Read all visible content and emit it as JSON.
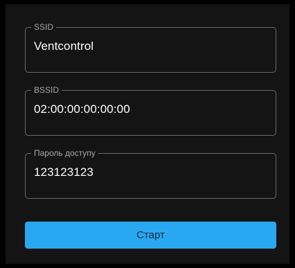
{
  "form": {
    "ssid": {
      "label": "SSID",
      "value": "Ventcontrol"
    },
    "bssid": {
      "label": "BSSID",
      "value": "02:00:00:00:00:00"
    },
    "password": {
      "label": "Пароль доступу",
      "value": "123123123"
    },
    "start_label": "Старт"
  },
  "colors": {
    "background": "#141414",
    "accent": "#29a8f2"
  }
}
